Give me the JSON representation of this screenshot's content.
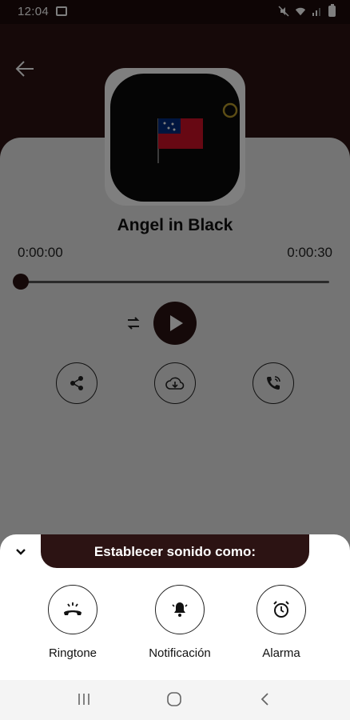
{
  "status_bar": {
    "time": "12:04"
  },
  "player": {
    "title": "Angel in Black",
    "elapsed": "0:00:00",
    "duration": "0:00:30",
    "progress": 0
  },
  "sheet": {
    "title": "Establecer sonido como:",
    "options": [
      {
        "label": "Ringtone",
        "icon": "ringtone-icon"
      },
      {
        "label": "Notificación",
        "icon": "notification-bell-icon"
      },
      {
        "label": "Alarma",
        "icon": "alarm-clock-icon"
      }
    ]
  },
  "colors": {
    "brand": "#2c1313",
    "sheet_bg": "#ffffff"
  }
}
